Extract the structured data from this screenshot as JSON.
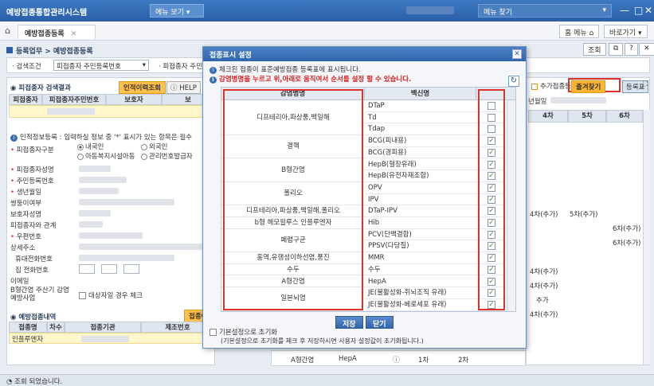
{
  "titlebar": {
    "app_title": "예방접종통합관리시스템",
    "menu_view": "메뉴 보기",
    "menu_open": "메뉴 찾기"
  },
  "tabbar": {
    "tab_label": "예방접종등록",
    "home_menu": "홈 메뉴",
    "shortcut": "바로가기"
  },
  "breadcrumb": "등록업무 > 예방접종등록",
  "toolbar": {
    "search": "조회"
  },
  "search_cond": {
    "label": "· 검색조건",
    "select_value": "피접종자 주민등록번호",
    "label2": "· 피접종자 주민등"
  },
  "left": {
    "result_title": "피접종자 검색결과",
    "history_btn": "인적이력조회",
    "help_btn": "HELP",
    "col_name": "피접종자",
    "col_rrn": "피접종자주민번호",
    "col_guardian": "보호자",
    "col_guardian2": "보",
    "person_info_note": "인적정보등록 : 입력하실 정보 중 '*' 표시가 있는 항목은 필수",
    "subject_type_label": "피접종자구분",
    "opt_domestic": "내국인",
    "opt_foreign": "외국인",
    "opt_child_facility": "아동복지시설아동",
    "opt_mgmt_no": "관리번호발급자",
    "name_label": "피접종자성명",
    "rrn_label": "주민등록번호",
    "birth_label": "생년월일",
    "other_label": "쌍둥이여부",
    "guardian_name_label": "보호자성명",
    "relation_label": "피접종자와 관계",
    "zip_label": "우편번호",
    "address_label": "상세주소",
    "mobile_label": "휴대전화번호",
    "home_phone_label": "집 전화번호",
    "email_label": "이메일",
    "hepb_label": "B형간염 주산기 감염 예방사업",
    "hepb_check": "대상자일 경우 체크",
    "vacc_history_title": "예방접종내역",
    "vacc_history_btn": "접종이",
    "h_col1": "접종명",
    "h_col2": "차수",
    "h_col3": "접종기관",
    "h_col4": "제조번호",
    "h_row1": "인플루엔자"
  },
  "bottom_row": {
    "disease": "A형간염",
    "vaccine": "HepA",
    "dose1": "1차",
    "dose2": "2차"
  },
  "right": {
    "add_check": "추가접종등록",
    "fav_btn": "즐겨찾기",
    "register_btn": "등록표",
    "birth_label": "년월일",
    "col4": "4차",
    "col5": "5차",
    "col6": "6차",
    "r1a": "4차(추가)",
    "r1b": "5차(추가)",
    "r2": "6차(추가)",
    "r3": "6차(추가)",
    "r4": "4차(추가)",
    "r5": "4차(추가)",
    "r6": "추가",
    "r7": "4차(추가)"
  },
  "modal": {
    "title": "접종표시 설정",
    "info1": "체크된 접종이 표준예방접종 등록표에 표시됩니다.",
    "info2": "감염병명을 누르고 위,아래로 움직여서 순서를 설정 할 수 있습니다.",
    "col_disease": "감염병명",
    "col_vaccine": "백신명",
    "save_btn": "저장",
    "close_btn": "닫기",
    "reset_label": "기본설정으로 초기화",
    "reset_note": "(기본설정으로 초기화를 체크 후 저장하시면 사용자 설정값이 초기화됩니다.)",
    "groups": [
      {
        "disease": "디프테리아,파상풍,백일해",
        "rows": 3
      },
      {
        "disease": "결핵",
        "rows": 2
      },
      {
        "disease": "B형간염",
        "rows": 2
      },
      {
        "disease": "폴리오",
        "rows": 2
      },
      {
        "disease": "디프테리아,파상풍,백일해,폴리오",
        "rows": 1
      },
      {
        "disease": "b형 헤모필루스 인플루엔자",
        "rows": 1
      },
      {
        "disease": "폐렴구균",
        "rows": 2
      },
      {
        "disease": "홍역,유행성이하선염,풍진",
        "rows": 1
      },
      {
        "disease": "수두",
        "rows": 1
      },
      {
        "disease": "A형간염",
        "rows": 1
      },
      {
        "disease": "일본뇌염",
        "rows": 2
      }
    ],
    "vaccines": [
      {
        "name": "DTaP",
        "checked": false
      },
      {
        "name": "Td",
        "checked": false
      },
      {
        "name": "Tdap",
        "checked": false
      },
      {
        "name": "BCG(피내용)",
        "checked": true
      },
      {
        "name": "BCG(경피용)",
        "checked": true
      },
      {
        "name": "HepB(혈장유래)",
        "checked": true
      },
      {
        "name": "HepB(유전자재조합)",
        "checked": true
      },
      {
        "name": "OPV",
        "checked": true
      },
      {
        "name": "IPV",
        "checked": true
      },
      {
        "name": "DTaP-IPV",
        "checked": true
      },
      {
        "name": "Hib",
        "checked": true
      },
      {
        "name": "PCV(단백결합)",
        "checked": true
      },
      {
        "name": "PPSV(다당질)",
        "checked": true
      },
      {
        "name": "MMR",
        "checked": true
      },
      {
        "name": "수두",
        "checked": true
      },
      {
        "name": "HepA",
        "checked": true
      },
      {
        "name": "JE(불활성화-쥐뇌조직 유래)",
        "checked": true
      },
      {
        "name": "JE(불활성화-베로세포 유래)",
        "checked": true
      }
    ]
  },
  "status": "조회 되었습니다."
}
